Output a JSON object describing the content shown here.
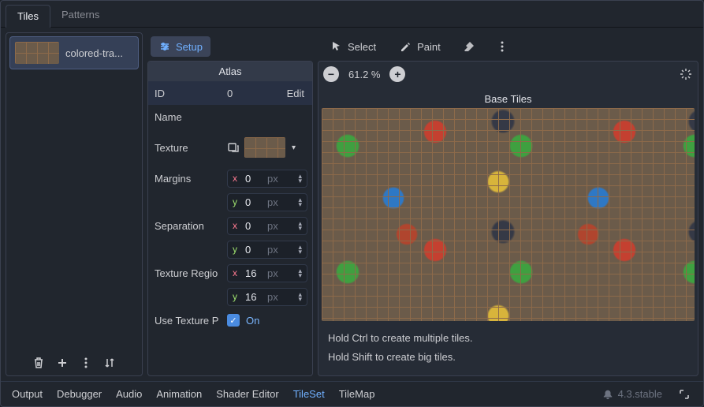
{
  "tabs": {
    "tiles": "Tiles",
    "patterns": "Patterns"
  },
  "sources": {
    "items": [
      {
        "label": "colored-tra..."
      }
    ]
  },
  "tools": {
    "setup": "Setup",
    "select": "Select",
    "paint": "Paint"
  },
  "atlas": {
    "header": "Atlas",
    "id_label": "ID",
    "id_value": "0",
    "edit": "Edit",
    "name_label": "Name",
    "name_value": "",
    "texture_label": "Texture",
    "margins_label": "Margins",
    "margins_x": "0",
    "margins_y": "0",
    "separation_label": "Separation",
    "separation_x": "0",
    "separation_y": "0",
    "region_label": "Texture Regio",
    "region_x": "16",
    "region_y": "16",
    "px": "px",
    "use_texture_label": "Use Texture P",
    "use_texture_on": "On"
  },
  "viewport": {
    "zoom": "61.2 %",
    "title": "Base Tiles",
    "hint1": "Hold Ctrl to create multiple tiles.",
    "hint2": "Hold Shift to create big tiles."
  },
  "bottom": {
    "output": "Output",
    "debugger": "Debugger",
    "audio": "Audio",
    "animation": "Animation",
    "shader": "Shader Editor",
    "tileset": "TileSet",
    "tilemap": "TileMap",
    "version": "4.3.stable"
  }
}
